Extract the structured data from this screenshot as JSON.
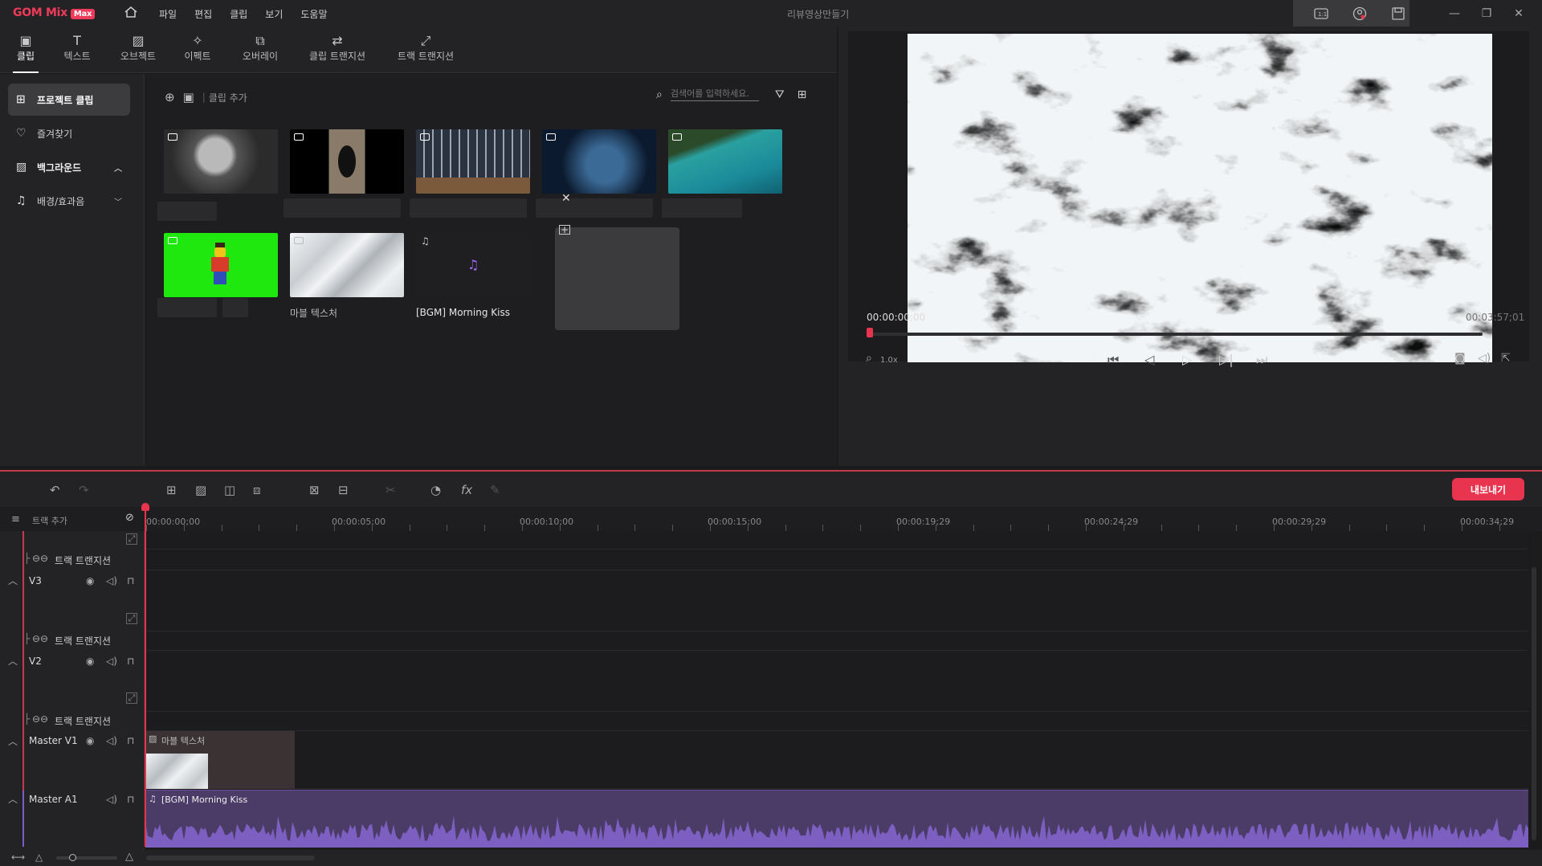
{
  "app": {
    "logo": "GOM Mix",
    "logo_badge": "Max",
    "doc_title": "리뷰영상만들기"
  },
  "menu": [
    "파일",
    "편집",
    "클립",
    "보기",
    "도움말"
  ],
  "tabs": [
    {
      "label": "클립",
      "icon": "clip-icon"
    },
    {
      "label": "텍스트",
      "icon": "text-icon"
    },
    {
      "label": "오브젝트",
      "icon": "object-icon"
    },
    {
      "label": "이펙트",
      "icon": "effect-icon"
    },
    {
      "label": "오버레이",
      "icon": "overlay-icon"
    },
    {
      "label": "클립 트랜지션",
      "icon": "clip-transition-icon"
    },
    {
      "label": "트랙 트랜지션",
      "icon": "track-transition-icon"
    }
  ],
  "sidebar": [
    {
      "label": "프로젝트 클립",
      "icon": "project-clip-icon"
    },
    {
      "label": "즐겨찾기",
      "icon": "heart-icon"
    },
    {
      "label": "백그라운드",
      "icon": "background-icon"
    },
    {
      "label": "배경/효과음",
      "icon": "music-icon"
    }
  ],
  "clips": {
    "add_label": "클립 추가",
    "search_placeholder": "검색어를 입력하세요.",
    "items": [
      {
        "caption": ""
      },
      {
        "caption": ""
      },
      {
        "caption": ""
      },
      {
        "caption": ""
      },
      {
        "caption": ""
      },
      {
        "caption": ""
      },
      {
        "caption": "마블 텍스처"
      },
      {
        "caption": "[BGM] Morning Kiss"
      }
    ]
  },
  "preview": {
    "current_time": "00:00:00;00",
    "total_time": "00:03:57;01",
    "zoom": "1.0x"
  },
  "timeline": {
    "export_label": "내보내기",
    "add_track_label": "트랙 추가",
    "ruler": [
      "00:00:00;00",
      "00:00:05;00",
      "00:00:10;00",
      "00:00:15;00",
      "00:00:19;29",
      "00:00:24;29",
      "00:00:29;29",
      "00:00:34;29"
    ],
    "track_transition_label": "트랙 트랜지션",
    "tracks": [
      "V3",
      "V2",
      "Master V1",
      "Master A1"
    ],
    "clip_v1": "마블 텍스처",
    "clip_a1": "[BGM] Morning Kiss"
  },
  "colors": {
    "accent": "#e8344f",
    "audio": "#6b4f9a",
    "bg": "#1b1b1c"
  }
}
